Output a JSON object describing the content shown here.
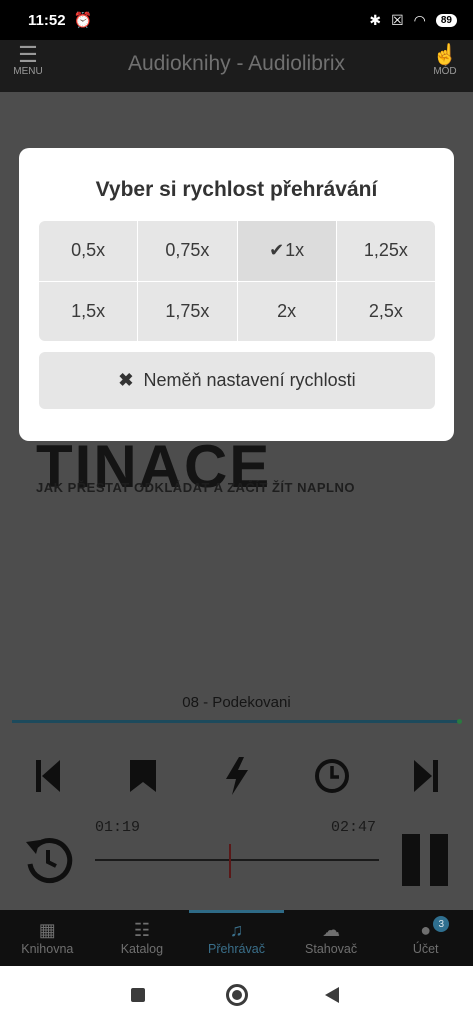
{
  "status_bar": {
    "time": "11:52",
    "battery": "89"
  },
  "app_bar": {
    "menu_label": "MENU",
    "title": "Audioknihy - Audiolibrix",
    "mode_label": "MÓD"
  },
  "player": {
    "cover_title": "TINACE",
    "cover_subtitle": "JAK PŘESTAT ODKLÁDAT A ZAČÍT ŽÍT NAPLNO",
    "track_name": "08 - Podekovani",
    "elapsed": "01:19",
    "duration": "02:47",
    "track_progress": 0.99,
    "seek_position": 0.47
  },
  "speed_dialog": {
    "title": "Vyber si rychlost přehrávání",
    "options": [
      "0,5x",
      "0,75x",
      "1x",
      "1,25x",
      "1,5x",
      "1,75x",
      "2x",
      "2,5x"
    ],
    "selected": "1x",
    "cancel_label": "Neměň nastavení rychlosti"
  },
  "bottom_nav": {
    "items": [
      {
        "label": "Knihovna",
        "icon": "grid-icon"
      },
      {
        "label": "Katalog",
        "icon": "list-icon"
      },
      {
        "label": "Přehrávač",
        "icon": "music-note-icon"
      },
      {
        "label": "Stahovač",
        "icon": "cloud-download-icon"
      },
      {
        "label": "Účet",
        "icon": "user-icon"
      }
    ],
    "active": "Přehrávač",
    "account_badge": "3"
  },
  "colors": {
    "accent": "#2e6a86",
    "modal_bg": "#ffffff",
    "button_bg": "#e6e6e6"
  }
}
